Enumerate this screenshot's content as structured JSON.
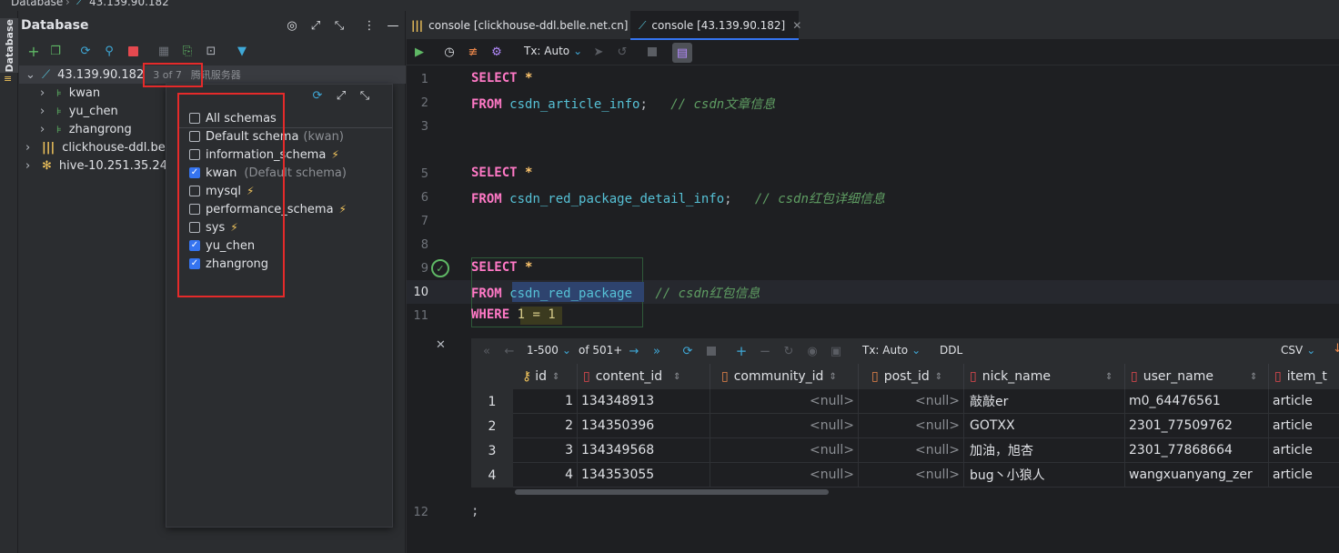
{
  "breadcrumb": {
    "root": "Database",
    "sep": "›",
    "host": "43.139.90.182"
  },
  "stripe_label": "Database",
  "db_panel": {
    "title": "Database",
    "tree": [
      {
        "label": "43.139.90.182",
        "badge": "3 of 7",
        "comment": "腾讯服务器"
      },
      {
        "label": "kwan"
      },
      {
        "label": "yu_chen"
      },
      {
        "label": "zhangrong"
      },
      {
        "label": "clickhouse-ddl.be"
      },
      {
        "label": "hive-10.251.35.24"
      }
    ]
  },
  "schema_popup": {
    "items": [
      {
        "label": "All schemas",
        "checked": false,
        "note": "",
        "bolt": false
      },
      {
        "label": "Default schema",
        "checked": false,
        "note": "(kwan)",
        "bolt": false
      },
      {
        "label": "information_schema",
        "checked": false,
        "note": "",
        "bolt": true
      },
      {
        "label": "kwan",
        "checked": true,
        "note": "(Default schema)",
        "bolt": false
      },
      {
        "label": "mysql",
        "checked": false,
        "note": "",
        "bolt": true
      },
      {
        "label": "performance_schema",
        "checked": false,
        "note": "",
        "bolt": true
      },
      {
        "label": "sys",
        "checked": false,
        "note": "",
        "bolt": true
      },
      {
        "label": "yu_chen",
        "checked": true,
        "note": "",
        "bolt": false
      },
      {
        "label": "zhangrong",
        "checked": true,
        "note": "",
        "bolt": false
      }
    ]
  },
  "tabs": [
    {
      "label": "console [clickhouse-ddl.belle.net.cn]",
      "active": false
    },
    {
      "label": "console [43.139.90.182]",
      "active": true
    }
  ],
  "editor_toolbar": {
    "tx_label": "Tx: Auto"
  },
  "code": {
    "line_numbers": [
      "1",
      "2",
      "3",
      "5",
      "6",
      "7",
      "8",
      "9",
      "10",
      "11",
      "12"
    ],
    "select": "SELECT",
    "star": "*",
    "from": "FROM",
    "where": "WHERE",
    "t1": "csdn_article_info",
    "t1_end": ";",
    "c1": "// csdn文章信息",
    "t2": "csdn_red_package_detail_info",
    "t2_end": ";",
    "c2": "// csdn红包详细信息",
    "t3": "csdn_red_package",
    "c3": "// csdn红包信息",
    "cond": "1 = 1",
    "semicolon": ";"
  },
  "result_toolbar": {
    "range": "1-500",
    "of": "of 501+",
    "tx": "Tx: Auto",
    "ddl": "DDL",
    "csv": "CSV"
  },
  "result": {
    "columns": [
      "id",
      "content_id",
      "community_id",
      "post_id",
      "nick_name",
      "user_name",
      "item_t"
    ],
    "rows": [
      {
        "n": "1",
        "id": "1",
        "content_id": "134348913",
        "community_id": "<null>",
        "post_id": "<null>",
        "nick_name": "敲敲er",
        "user_name": "m0_64476561",
        "item": "article"
      },
      {
        "n": "2",
        "id": "2",
        "content_id": "134350396",
        "community_id": "<null>",
        "post_id": "<null>",
        "nick_name": "GOTXX",
        "user_name": "2301_77509762",
        "item": "article"
      },
      {
        "n": "3",
        "id": "3",
        "content_id": "134349568",
        "community_id": "<null>",
        "post_id": "<null>",
        "nick_name": "加油，旭杏",
        "user_name": "2301_77868664",
        "item": "article"
      },
      {
        "n": "4",
        "id": "4",
        "content_id": "134353055",
        "community_id": "<null>",
        "post_id": "<null>",
        "nick_name": "bug丶小狼人",
        "user_name": "wangxuanyang_zer",
        "item": "article"
      }
    ]
  }
}
